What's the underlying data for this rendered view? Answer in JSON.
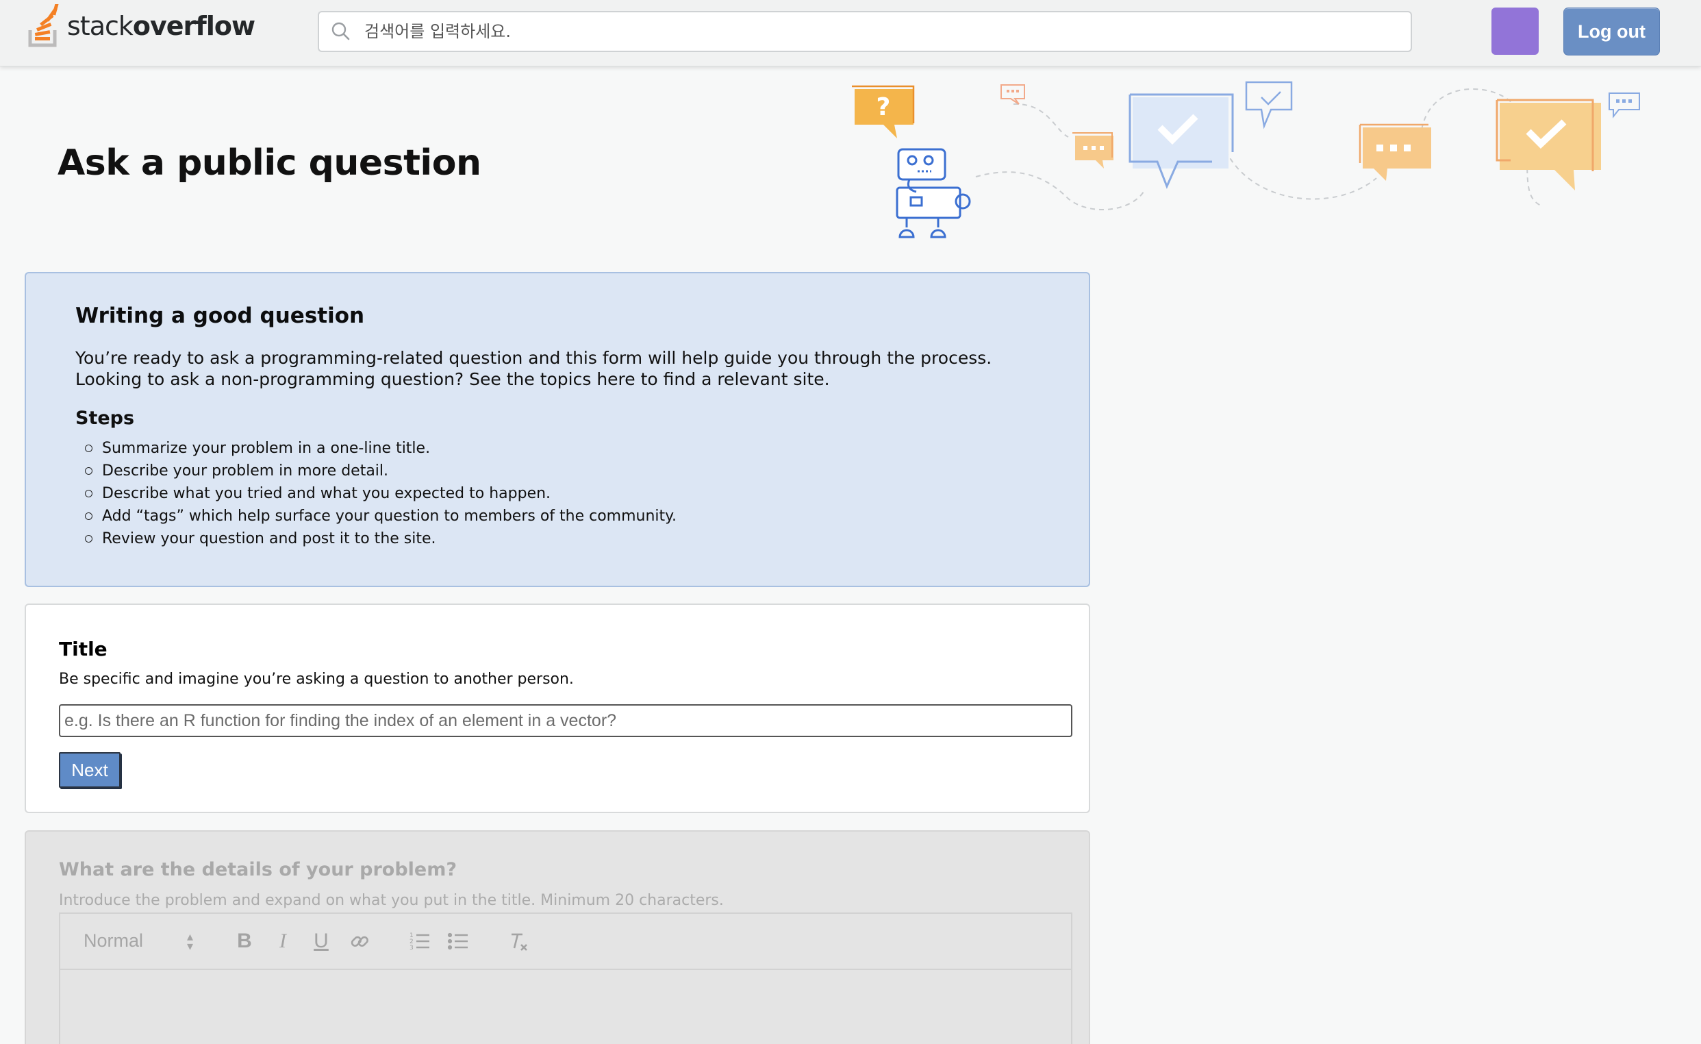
{
  "header": {
    "logo_text_light": "stack",
    "logo_text_bold": "overflow",
    "search_placeholder": "검색어를 입력하세요.",
    "logout_label": "Log out"
  },
  "page": {
    "title": "Ask a public question"
  },
  "guide": {
    "heading": "Writing a good question",
    "intro_line1": "You’re ready to ask a programming-related question and this form will help guide you through the process.",
    "intro_line2": "Looking to ask a non-programming question? See the topics here to find a relevant site.",
    "steps_heading": "Steps",
    "steps": [
      "Summarize your problem in a one-line title.",
      "Describe your problem in more detail.",
      "Describe what you tried and what you expected to happen.",
      "Add “tags” which help surface your question to members of the community.",
      "Review your question and post it to the site."
    ]
  },
  "title_section": {
    "label": "Title",
    "description": "Be specific and imagine you’re asking a question to another person.",
    "placeholder": "e.g. Is there an R function for finding the index of an element in a vector?",
    "next_label": "Next"
  },
  "details_section": {
    "label": "What are the details of your problem?",
    "description": "Introduce the problem and expand on what you put in the title. Minimum 20 characters.",
    "format_select": "Normal"
  },
  "colors": {
    "accent_blue": "#5f8bc7",
    "avatar": "#9274d8",
    "logo_orange": "#f48024",
    "guide_bg": "#dce6f4"
  }
}
